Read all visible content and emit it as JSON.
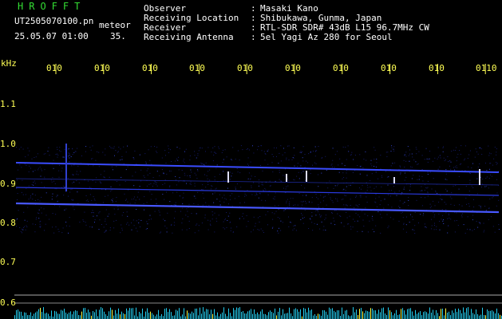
{
  "header": {
    "brand": "HROFFT",
    "filename": "UT2505070100.pn",
    "tag": "meteor",
    "date_time": "25.05.07 01:00",
    "counter": "35."
  },
  "info": [
    {
      "label": "Observer",
      "value": "Masaki Kano"
    },
    {
      "label": "Receiving Location",
      "value": "Shibukawa, Gunma, Japan"
    },
    {
      "label": "Receiver",
      "value": "RTL-SDR SDR# 43dB L15 96.7MHz CW"
    },
    {
      "label": "Receiving Antenna",
      "value": "5el Yagi Az 280 for Seoul"
    }
  ],
  "time_ticks": [
    "010",
    "010",
    "010",
    "010",
    "010",
    "010",
    "010",
    "010",
    "010",
    "0110"
  ],
  "freq_axis": {
    "unit": "kHz",
    "labels": [
      "1.1",
      "1.0",
      "0.9",
      "0.8",
      "0.7",
      "0.6"
    ]
  },
  "colors": {
    "background": "#000000",
    "brand": "#33dd33",
    "labels": "#ffff55",
    "trace": "#2a3cff",
    "bars": "#22ccee"
  }
}
